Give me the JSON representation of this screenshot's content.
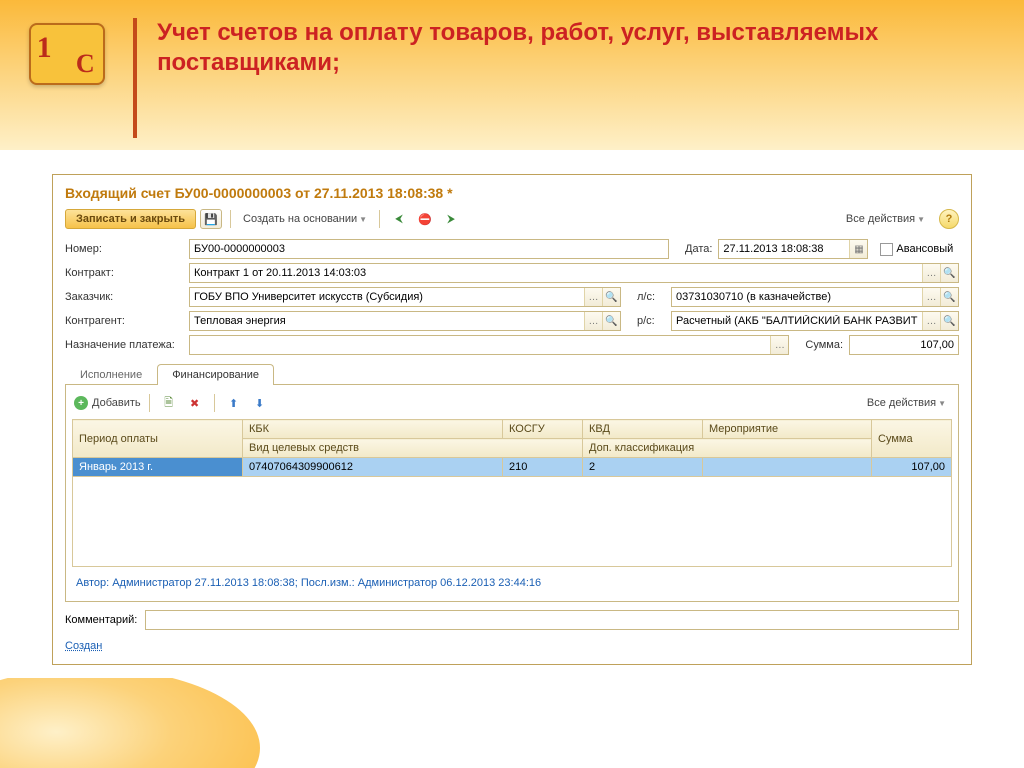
{
  "banner": {
    "title": "Учет счетов на оплату товаров, работ, услуг, выставляемых поставщиками;"
  },
  "window": {
    "title": "Входящий счет БУ00-0000000003 от 27.11.2013 18:08:38 *"
  },
  "toolbar": {
    "save_close": "Записать и закрыть",
    "create_on_basis": "Создать на основании",
    "all_actions": "Все действия"
  },
  "fields": {
    "number_label": "Номер:",
    "number_value": "БУ00-0000000003",
    "date_label": "Дата:",
    "date_value": "27.11.2013 18:08:38",
    "advance_label": "Авансовый",
    "contract_label": "Контракт:",
    "contract_value": "Контракт 1 от 20.11.2013 14:03:03",
    "customer_label": "Заказчик:",
    "customer_value": "ГОБУ ВПО Университет искусств (Субсидия)",
    "ls_label": "л/с:",
    "ls_value": "03731030710 (в казначействе)",
    "counterparty_label": "Контрагент:",
    "counterparty_value": "Тепловая энергия",
    "rs_label": "р/с:",
    "rs_value": "Расчетный (АКБ \"БАЛТИЙСКИЙ БАНК РАЗВИТИЯ\" (ЗАО))",
    "purpose_label": "Назначение платежа:",
    "purpose_value": "",
    "sum_label": "Сумма:",
    "sum_value": "107,00"
  },
  "tabs": {
    "tab1": "Исполнение",
    "tab2": "Финансирование"
  },
  "panel_tb": {
    "add": "Добавить",
    "all_actions": "Все действия"
  },
  "grid": {
    "headers": {
      "period": "Период оплаты",
      "kbk": "КБК",
      "kosgu": "КОСГУ",
      "kvd": "КВД",
      "event": "Мероприятие",
      "sum": "Сумма",
      "target_type": "Вид целевых средств",
      "add_class": "Доп. классификация"
    },
    "row": {
      "period": "Январь 2013 г.",
      "kbk": "07407064309900612",
      "kosgu": "210",
      "kvd": "2",
      "event": "",
      "sum": "107,00"
    }
  },
  "audit": "Автор: Администратор 27.11.2013 18:08:38; Посл.изм.: Администратор 06.12.2013 23:44:16",
  "comment": {
    "label": "Комментарий:",
    "value": "",
    "created": "Создан"
  }
}
